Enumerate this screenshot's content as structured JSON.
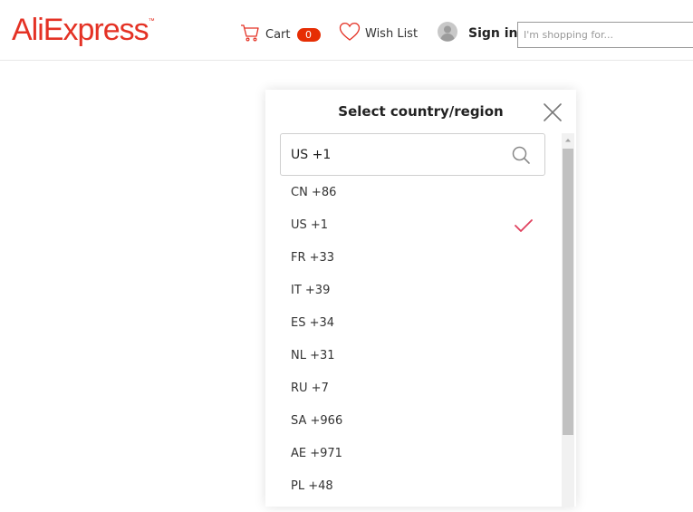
{
  "header": {
    "logo": "AliExpress",
    "logo_mark": "™",
    "cart_label": "Cart",
    "cart_count": "0",
    "wishlist_label": "Wish List",
    "signin_label": "Sign in",
    "search_placeholder": "I'm shopping for..."
  },
  "modal": {
    "title": "Select country/region",
    "search_value": "US +1",
    "selected": "US +1",
    "items": [
      {
        "label": "CN +86",
        "selected": false
      },
      {
        "label": "US +1",
        "selected": true
      },
      {
        "label": "FR +33",
        "selected": false
      },
      {
        "label": "IT +39",
        "selected": false
      },
      {
        "label": "ES +34",
        "selected": false
      },
      {
        "label": "NL +31",
        "selected": false
      },
      {
        "label": "RU +7",
        "selected": false
      },
      {
        "label": "SA +966",
        "selected": false
      },
      {
        "label": "AE +971",
        "selected": false
      },
      {
        "label": "PL +48",
        "selected": false
      }
    ]
  },
  "colors": {
    "brand": "#e43225",
    "badge": "#e62e04",
    "check": "#e0415e"
  },
  "icons": {
    "cart": "cart-icon",
    "wishlist": "heart-icon",
    "user": "user-avatar-icon",
    "close": "close-icon",
    "search": "search-icon",
    "check": "check-icon",
    "scroll_up": "scroll-up-arrow-icon"
  }
}
